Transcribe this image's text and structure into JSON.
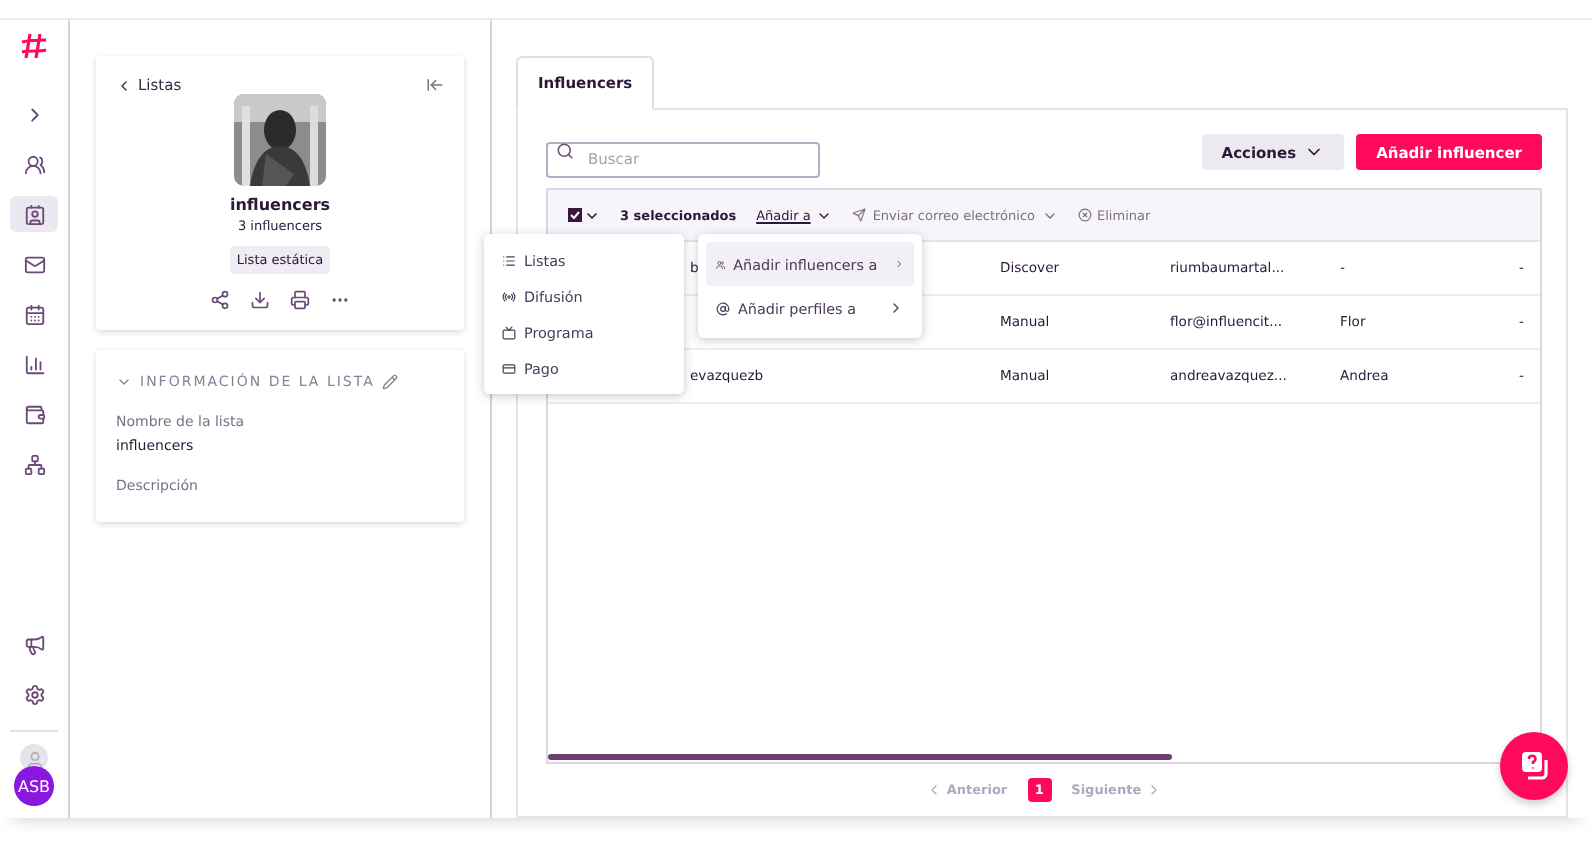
{
  "sidebar": {
    "nav": [
      {
        "kind": "expand",
        "selected": false
      },
      {
        "kind": "users",
        "selected": false
      },
      {
        "kind": "contacts",
        "selected": true
      },
      {
        "kind": "mail",
        "selected": false
      },
      {
        "kind": "calendar",
        "selected": false
      },
      {
        "kind": "chart",
        "selected": false
      },
      {
        "kind": "wallet",
        "selected": false
      },
      {
        "kind": "network",
        "selected": false
      }
    ],
    "bottom": [
      {
        "kind": "megaphone",
        "selected": false
      },
      {
        "kind": "settings",
        "selected": false
      }
    ],
    "user_initials": "ASB"
  },
  "list_card": {
    "back_label": "Listas",
    "name": "influencers",
    "count": "3 influencers",
    "badge": "Lista estática"
  },
  "info_card": {
    "title": "INFORMACIÓN DE LA LISTA",
    "expanded": true,
    "fields": [
      {
        "label": "Nombre de la lista",
        "value": "influencers"
      },
      {
        "label": "Descripción"
      }
    ]
  },
  "tabs": [
    {
      "label": "Influencers",
      "selected": true
    }
  ],
  "search": {
    "placeholder": "Buscar"
  },
  "actions_button": "Acciones",
  "add_button": "Añadir influencer",
  "bulk_bar": {
    "checked": true,
    "selected_count": "3 seleccionados",
    "add_to": "Añadir a",
    "email": "Enviar correo electrónico",
    "delete": "Eliminar"
  },
  "rows": [
    {
      "name": "b",
      "source": "Discover",
      "email": "riumbaumartal...",
      "first_name": "-",
      "column_5": "-"
    },
    {
      "source": "Manual",
      "email": "flor@influencit...",
      "first_name": "Flor",
      "column_5": "-"
    },
    {
      "name": "evazquezb",
      "source": "Manual",
      "email": "andreavazquez...",
      "first_name": "Andrea",
      "column_5": "-"
    }
  ],
  "add_menu": [
    {
      "kind": "list",
      "label": "Listas"
    },
    {
      "kind": "broadcast",
      "label": "Difusión"
    },
    {
      "kind": "program",
      "label": "Programa"
    },
    {
      "kind": "payment",
      "label": "Pago"
    }
  ],
  "sub_menu": [
    {
      "kind": "influencers",
      "label": "Añadir influencers a",
      "selected": true
    },
    {
      "kind": "profiles",
      "label": "Añadir perfiles a",
      "selected": false
    }
  ],
  "pagination": {
    "previous": "Anterior",
    "pages": [
      {
        "label": "1",
        "selected": true
      }
    ],
    "next": "Siguiente"
  }
}
